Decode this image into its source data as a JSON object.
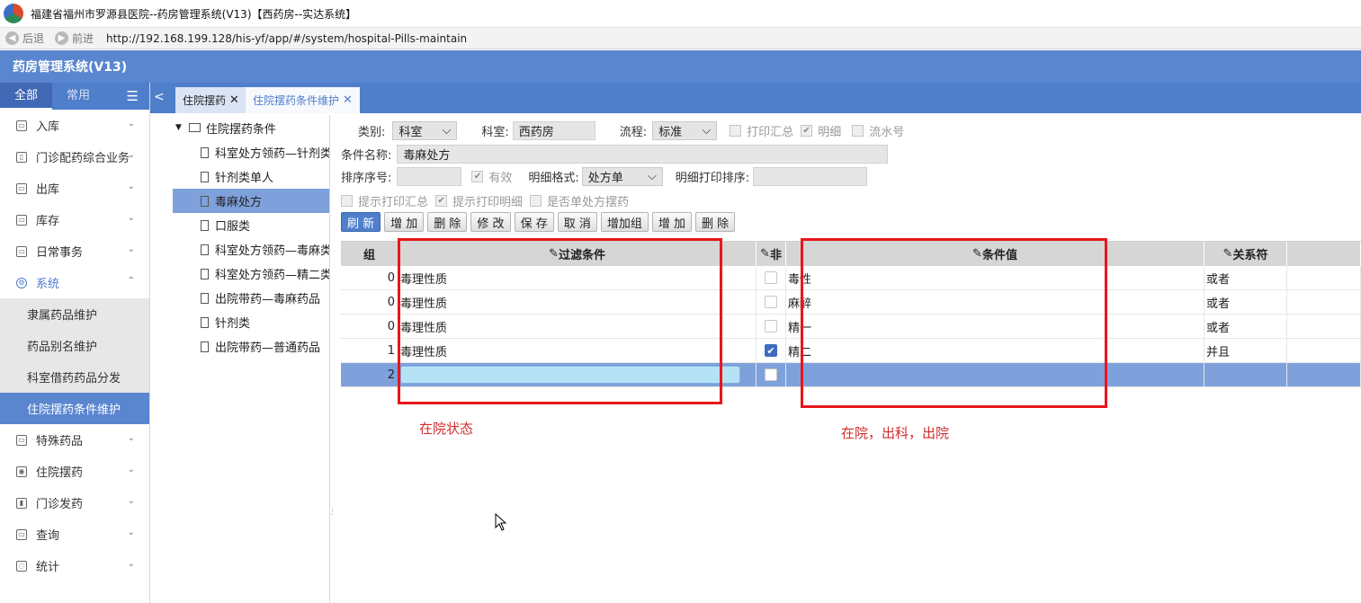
{
  "window": {
    "title": "福建省福州市罗源县医院--药房管理系统(V13)【西药房--实达系统】"
  },
  "address_bar": {
    "back": "后退",
    "forward": "前进",
    "url": "http://192.168.199.128/his-yf/app/#/system/hospital-Pills-maintain"
  },
  "app": {
    "name": "药房管理系统(V13)"
  },
  "sidebar": {
    "tabs": {
      "all": "全部",
      "common": "常用"
    },
    "items": [
      {
        "label": "入库",
        "icon": "inbox-icon"
      },
      {
        "label": "门诊配药综合业务",
        "icon": "lock-icon"
      },
      {
        "label": "出库",
        "icon": "outbox-icon"
      },
      {
        "label": "库存",
        "icon": "stock-icon"
      },
      {
        "label": "日常事务",
        "icon": "calendar-icon"
      },
      {
        "label": "系统",
        "icon": "gear-icon"
      }
    ],
    "sub_items": [
      "隶属药品维护",
      "药品别名维护",
      "科室借药药品分发",
      "住院摆药条件维护"
    ],
    "items_after": [
      {
        "label": "特殊药品",
        "icon": "special-icon"
      },
      {
        "label": "住院摆药",
        "icon": "pill-icon"
      },
      {
        "label": "门诊发药",
        "icon": "dispense-icon"
      },
      {
        "label": "查询",
        "icon": "search-icon"
      },
      {
        "label": "统计",
        "icon": "stats-icon"
      }
    ]
  },
  "tabs": [
    {
      "label": "住院摆药"
    },
    {
      "label": "住院摆药条件维护"
    }
  ],
  "tree": {
    "root": "住院摆药条件",
    "nodes": [
      "科室处方领药—针剂类",
      "针剂类单人",
      "毒麻处方",
      "口服类",
      "科室处方领药—毒麻类",
      "科室处方领药—精二类",
      "出院带药—毒麻药品",
      "针剂类",
      "出院带药—普通药品"
    ]
  },
  "form": {
    "category_label": "类别:",
    "category_value": "科室",
    "dept_label": "科室:",
    "dept_value": "西药房",
    "flow_label": "流程:",
    "flow_value": "标准",
    "print_summary": "打印汇总",
    "detail": "明细",
    "serial": "流水号",
    "cond_name_label": "条件名称:",
    "cond_name_value": "毒麻处方",
    "sort_label": "排序序号:",
    "valid": "有效",
    "detail_format_label": "明细格式:",
    "detail_format_value": "处方单",
    "detail_print_sort_label": "明细打印排序:",
    "hint_print_summary": "提示打印汇总",
    "hint_print_detail": "提示打印明细",
    "single_rx": "是否单处方摆药"
  },
  "toolbar": {
    "refresh": "刷 新",
    "add": "增 加",
    "delete": "删 除",
    "edit": "修 改",
    "save": "保 存",
    "cancel": "取 消",
    "add_group": "增加组",
    "add2": "增 加",
    "delete2": "删 除"
  },
  "grid": {
    "headers": {
      "group": "组",
      "filter": "过滤条件",
      "not": "非",
      "value": "条件值",
      "relation": "关系符"
    },
    "rows": [
      {
        "group": "0",
        "filter": "毒理性质",
        "not": false,
        "value": "毒性",
        "relation": "或者"
      },
      {
        "group": "0",
        "filter": "毒理性质",
        "not": false,
        "value": "麻醉",
        "relation": "或者"
      },
      {
        "group": "0",
        "filter": "毒理性质",
        "not": false,
        "value": "精一",
        "relation": "或者"
      },
      {
        "group": "1",
        "filter": "毒理性质",
        "not": true,
        "value": "精二",
        "relation": "并且"
      },
      {
        "group": "2",
        "filter": "",
        "not": false,
        "value": "",
        "relation": ""
      }
    ]
  },
  "annotations": {
    "left": "在院状态",
    "right": "在院，出科，出院"
  },
  "colors": {
    "header_blue": "#5a86d0",
    "tab_blue": "#4f7ecb",
    "selected_row": "#7ea1dc",
    "annotation_red": "#e8161c"
  }
}
